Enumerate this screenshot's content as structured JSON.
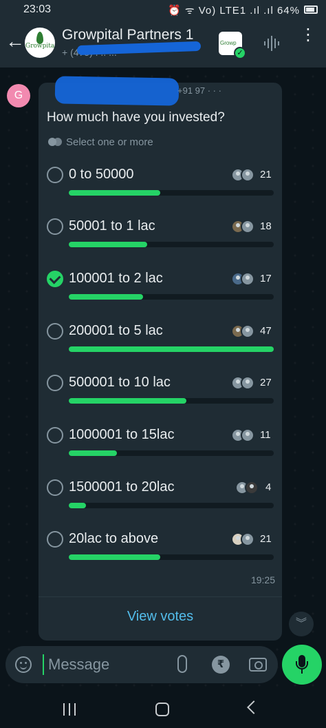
{
  "status_bar": {
    "time": "23:03",
    "icons": "⏰ ᯤ Vo) LTE1 .ıl .ıl",
    "battery": "64%"
  },
  "header": {
    "title": "Growpital Partners 1",
    "subtitle": "+ (475) . .. ...",
    "avatar_text": "Growpita",
    "thumb_text": "Growp"
  },
  "message": {
    "sender_initial": "G",
    "sender_number": "+91 97 · · · ",
    "time": "19:25"
  },
  "poll": {
    "question": "How much have you invested?",
    "hint": "Select one or more",
    "options": [
      {
        "label": "0 to 50000",
        "votes": "21",
        "fraction": 0.447,
        "checked": false
      },
      {
        "label": "50001 to 1 lac",
        "votes": "18",
        "fraction": 0.383,
        "checked": false
      },
      {
        "label": "100001 to 2 lac",
        "votes": "17",
        "fraction": 0.362,
        "checked": true
      },
      {
        "label": "200001 to 5 lac",
        "votes": "47",
        "fraction": 1.0,
        "checked": false
      },
      {
        "label": "500001 to 10 lac",
        "votes": "27",
        "fraction": 0.574,
        "checked": false
      },
      {
        "label": "1000001 to 15lac",
        "votes": "11",
        "fraction": 0.234,
        "checked": false
      },
      {
        "label": "1500001 to 20lac",
        "votes": "4",
        "fraction": 0.085,
        "checked": false
      },
      {
        "label": "20lac to above",
        "votes": "21",
        "fraction": 0.447,
        "checked": false
      }
    ],
    "view_votes": "View votes"
  },
  "input": {
    "placeholder": "Message",
    "rupee_symbol": "₹"
  },
  "colors": {
    "accent": "#25d366",
    "link": "#53bdeb",
    "bubble": "#1f2c34",
    "background": "#0b141a"
  }
}
